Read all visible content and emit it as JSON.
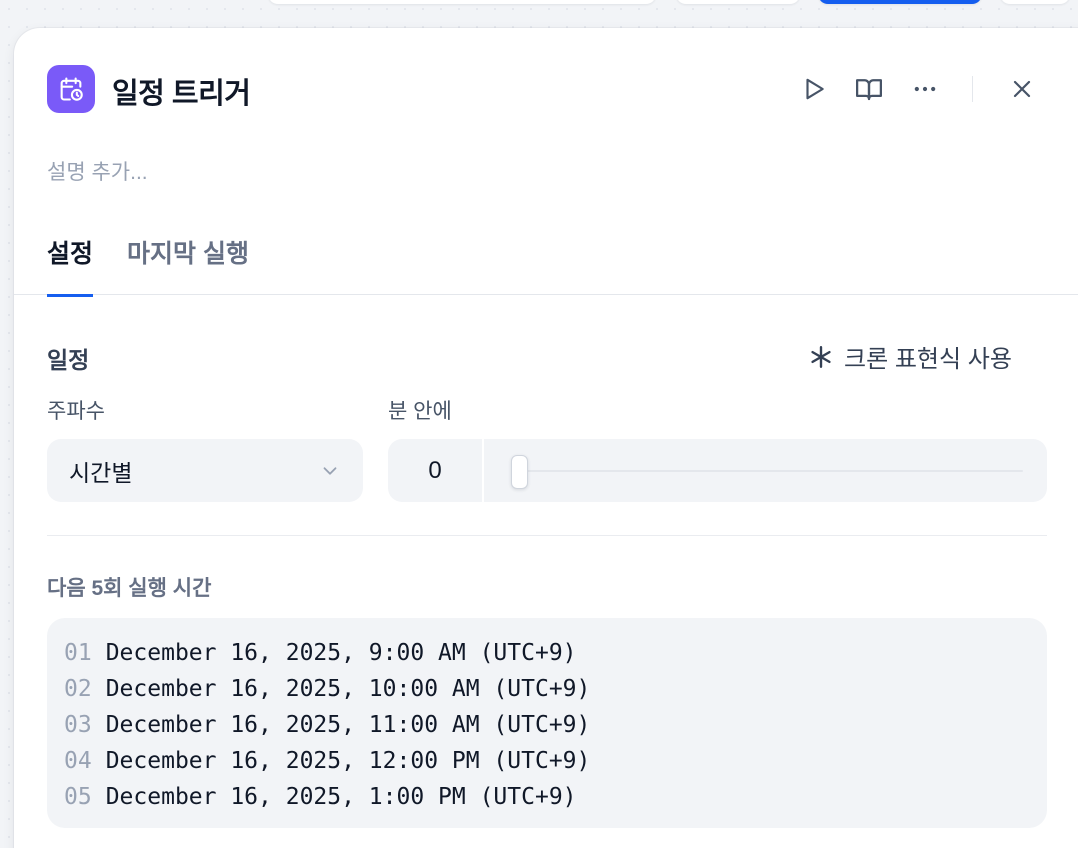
{
  "panel": {
    "title": "일정 트리거",
    "description_placeholder": "설명 추가...",
    "icon": "calendar-clock-icon",
    "accent_color": "#7a5af8"
  },
  "header_actions": {
    "run": "play-icon",
    "docs": "book-open-icon",
    "more": "more-horizontal-icon",
    "close": "close-icon"
  },
  "tabs": [
    {
      "label": "설정",
      "active": true
    },
    {
      "label": "마지막 실행",
      "active": false
    }
  ],
  "schedule": {
    "section_title": "일정",
    "cron_toggle_label": "크론 표현식 사용",
    "frequency_label": "주파수",
    "frequency_value": "시간별",
    "minute_label": "분 안에",
    "minute_value": "0"
  },
  "next_runs": {
    "title": "다음 5회 실행 시간",
    "rows": [
      {
        "num": "01",
        "text": "December 16, 2025, 9:00 AM (UTC+9)"
      },
      {
        "num": "02",
        "text": "December 16, 2025, 10:00 AM (UTC+9)"
      },
      {
        "num": "03",
        "text": "December 16, 2025, 11:00 AM (UTC+9)"
      },
      {
        "num": "04",
        "text": "December 16, 2025, 12:00 PM (UTC+9)"
      },
      {
        "num": "05",
        "text": "December 16, 2025, 1:00 PM (UTC+9)"
      }
    ]
  }
}
